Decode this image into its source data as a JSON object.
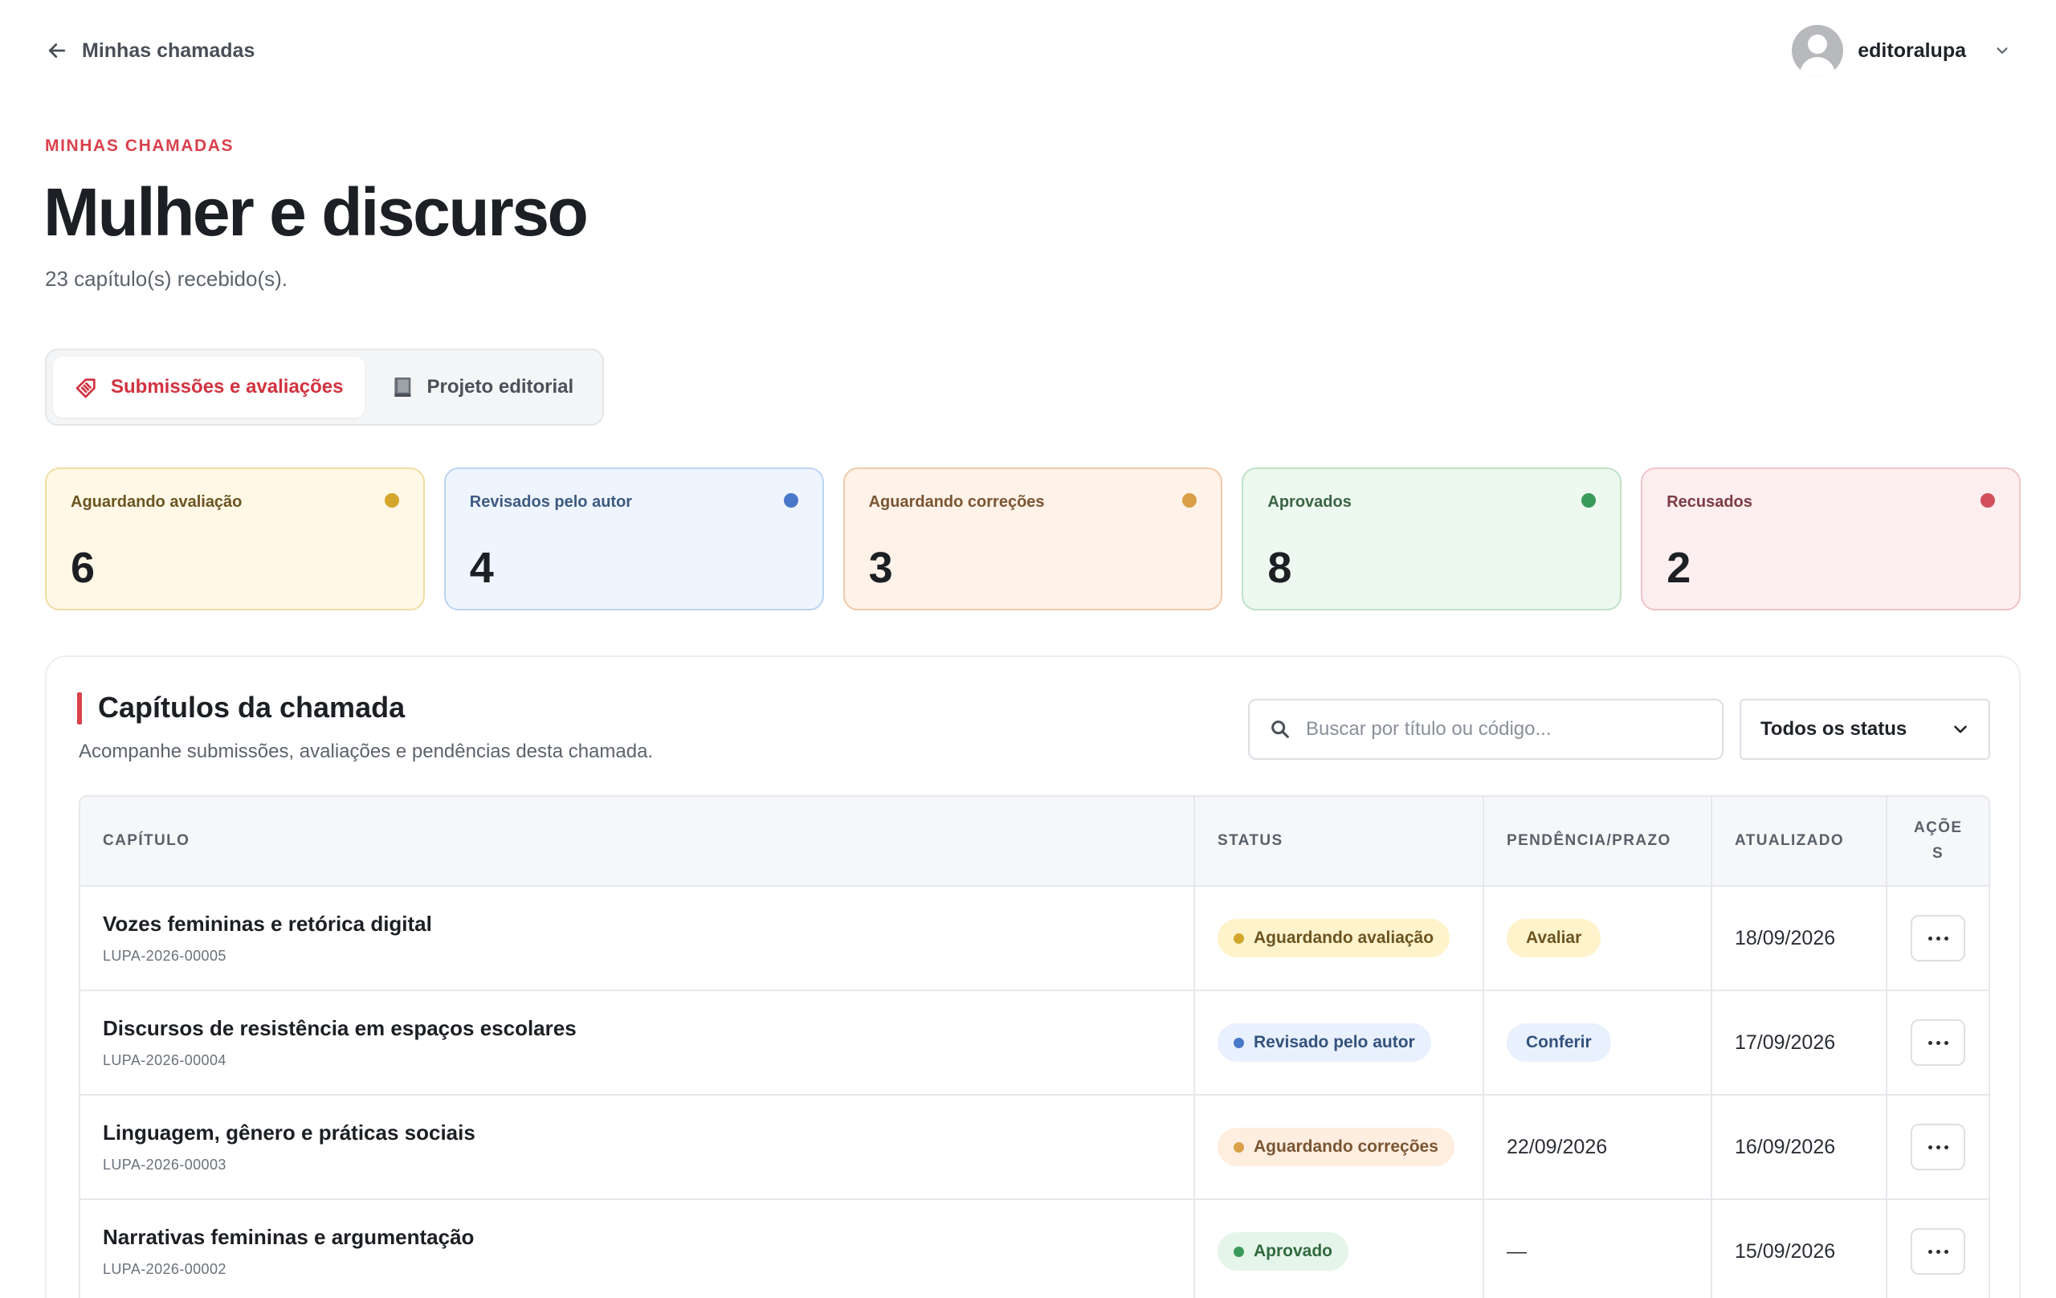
{
  "topbar": {
    "back_label": "Minhas chamadas",
    "username": "editoralupa"
  },
  "header": {
    "eyebrow": "MINHAS CHAMADAS",
    "title": "Mulher e discurso",
    "subtitle": "23 capítulo(s) recebido(s)."
  },
  "tabs": [
    {
      "label": "Submissões e avaliações",
      "active": true
    },
    {
      "label": "Projeto editorial",
      "active": false
    }
  ],
  "stats": [
    {
      "label": "Aguardando avaliação",
      "value": "6",
      "bg": "#fff8e6",
      "border": "#f1dca5",
      "text": "#6b5420",
      "dot": "#d4a72c"
    },
    {
      "label": "Revisados pelo autor",
      "value": "4",
      "bg": "#eef5ff",
      "border": "#bcd4f3",
      "text": "#3e5a82",
      "dot": "#4a78c8"
    },
    {
      "label": "Aguardando correções",
      "value": "3",
      "bg": "#fff2e8",
      "border": "#f2c9a8",
      "text": "#7a5532",
      "dot": "#d9a048"
    },
    {
      "label": "Aprovados",
      "value": "8",
      "bg": "#edf8ef",
      "border": "#bfe2c6",
      "text": "#3b6444",
      "dot": "#3a9a5b"
    },
    {
      "label": "Recusados",
      "value": "2",
      "bg": "#fdeeef",
      "border": "#f2c3c7",
      "text": "#7d3b42",
      "dot": "#d1505c"
    }
  ],
  "panel": {
    "title": "Capítulos da chamada",
    "subtitle": "Acompanhe submissões, avaliações e pendências desta chamada.",
    "search_placeholder": "Buscar por título ou código...",
    "status_filter": "Todos os status"
  },
  "table": {
    "headers": {
      "chapter": "CAPÍTULO",
      "status": "STATUS",
      "pending": "PENDÊNCIA/PRAZO",
      "updated": "ATUALIZADO",
      "actions": "AÇÕE S"
    },
    "rows": [
      {
        "title": "Vozes femininas e retórica digital",
        "code": "LUPA-2026-00005",
        "status": "Aguardando avaliação",
        "pending": "Avaliar",
        "pending_type": "pill",
        "updated": "18/09/2026"
      },
      {
        "title": "Discursos de resistência em espaços escolares",
        "code": "LUPA-2026-00004",
        "status": "Revisado pelo autor",
        "pending": "Conferir",
        "pending_type": "pill",
        "updated": "17/09/2026"
      },
      {
        "title": "Linguagem, gênero e práticas sociais",
        "code": "LUPA-2026-00003",
        "status": "Aguardando correções",
        "pending": "22/09/2026",
        "pending_type": "text",
        "updated": "16/09/2026"
      },
      {
        "title": "Narrativas femininas e argumentação",
        "code": "LUPA-2026-00002",
        "status": "Aprovado",
        "pending": "—",
        "pending_type": "text",
        "updated": "15/09/2026"
      }
    ]
  },
  "colors": {
    "accent": "#d9414d",
    "status_waiting_eval": {
      "bg": "#fff3cc",
      "fg": "#6b5420",
      "dot": "#d4a72c"
    },
    "status_revised": {
      "bg": "#e8f1fd",
      "fg": "#34527d",
      "dot": "#4a78c8"
    },
    "status_corrections": {
      "bg": "#fdeee0",
      "fg": "#7a5532",
      "dot": "#d9a048"
    },
    "status_approved": {
      "bg": "#e6f5ea",
      "fg": "#2f6a3e",
      "dot": "#3a9a5b"
    }
  }
}
